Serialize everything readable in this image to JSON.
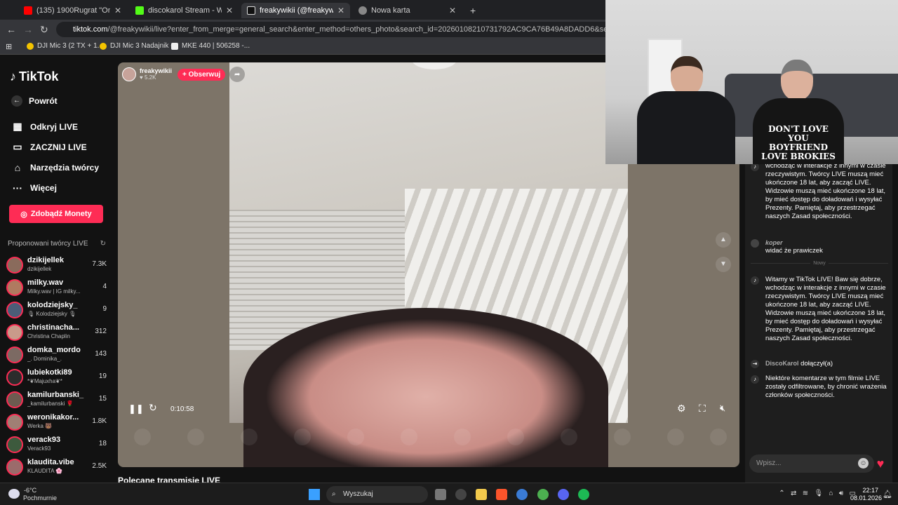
{
  "browser": {
    "tabs": [
      {
        "title": "(135) 1900Rugrat \"One Take Fr",
        "color": "#ff0000",
        "close": "✕"
      },
      {
        "title": "discokarol Stream - Watch Live",
        "color": "#53fc18",
        "close": "✕"
      },
      {
        "title": "freakywikii (@freakywikii) prow",
        "color": "#111111",
        "close": "✕",
        "active": true
      },
      {
        "title": "Nowa karta",
        "color": "#888888",
        "close": "✕"
      }
    ],
    "new_tab": "+",
    "url_host": "tiktok.com",
    "url_rest": "/@freakywikii/live?enter_from_merge=general_search&enter_method=others_photo&search_id=20260108210731792AC9CA76B49A8DADD6&search_keyword=freakywikii&se",
    "bookmarks": [
      "DJI Mic 3 (2 TX + 1...",
      "DJI Mic 3 Nadajnik -...",
      "MKE 440 | 506258 -..."
    ]
  },
  "sidebar": {
    "brand": "TikTok",
    "back": "Powrót",
    "items": [
      {
        "label": "Odkryj LIVE",
        "icon": "calendar-icon"
      },
      {
        "label": "ZACZNIJ LIVE",
        "icon": "video-icon"
      },
      {
        "label": "Narzędzia twórcy",
        "icon": "home-icon"
      },
      {
        "label": "Więcej",
        "icon": "more-icon"
      }
    ],
    "coins_button": "Zdobądź Monety",
    "proposed_title": "Proponowani twórcy LIVE",
    "creators": [
      {
        "name": "dzikijellek",
        "sub": "dzikijellek",
        "count": "7.3K",
        "color": "#8a6b5c"
      },
      {
        "name": "milky.wav",
        "sub": "Milky.wav | IG milky...",
        "count": "4",
        "color": "#b07a60"
      },
      {
        "name": "kolodziejsky_",
        "sub": "🎙 Kolodziejsky 🎙",
        "count": "9",
        "color": "#4b5d78"
      },
      {
        "name": "christinacha...",
        "sub": "Christina Chaplin",
        "count": "312",
        "color": "#c99a8a"
      },
      {
        "name": "domka_mordo",
        "sub": "_. Dominika_.",
        "count": "143",
        "color": "#7c6a63"
      },
      {
        "name": "lubiekotki89",
        "sub": "*❦Majuxha❦*",
        "count": "19",
        "color": "#2c2c2c"
      },
      {
        "name": "kamilurbanski_",
        "sub": "_kamilurbanski 🌹",
        "count": "15",
        "color": "#6d5b50"
      },
      {
        "name": "weronikakor...",
        "sub": "Werka 🐻",
        "count": "1.8K",
        "color": "#a07f74"
      },
      {
        "name": "verack93",
        "sub": "Verack93",
        "count": "18",
        "color": "#3d5a3d"
      },
      {
        "name": "klaudita.vibe",
        "sub": "KLAUDITA 🌸",
        "count": "2.5K",
        "color": "#9b6b6b"
      }
    ]
  },
  "player": {
    "host": "freakywikii",
    "likes": "♥ 5.2K",
    "follow": "+ Obserwuj",
    "time": "0:10:58"
  },
  "recommended_title": "Polecane transmisje LIVE",
  "chat": {
    "messages": [
      {
        "user": "",
        "text": "wchodząc w interakcje z innymi w czasie rzeczywistym. Twórcy LIVE muszą mieć ukończone 18 lat, aby zacząć LIVE. Widzowie muszą mieć ukończone 18 lat, by mieć dostęp do doładowań i wysyłać Prezenty. Pamiętaj, aby przestrzegać naszych Zasad społeczności."
      },
      {
        "user": "koper",
        "text": "widać że prawiczek"
      }
    ],
    "new_label": "Nowy",
    "messages_new": [
      {
        "user": "",
        "text": "Witamy w TikTok LIVE! Baw się dobrze, wchodząc w interakcje z innymi w czasie rzeczywistym. Twórcy LIVE muszą mieć ukończone 18 lat, aby zacząć LIVE. Widzowie muszą mieć ukończone 18 lat, by mieć dostęp do doładowań i wysyłać Prezenty. Pamiętaj, aby przestrzegać naszych Zasad społeczności."
      },
      {
        "user": "DiscoKarol",
        "text": "dołączył(a)"
      },
      {
        "user": "",
        "text": "Niektóre komentarze w tym filmie LIVE zostały odfiltrowane, by chronić wrażenia członków społeczności."
      }
    ],
    "input_placeholder": "Wpisz..."
  },
  "webcam": {
    "shirt_text": "DON'T LOVE YOU BOYFRIEND LOVE BROKIES"
  },
  "taskbar": {
    "temp": "-6°C",
    "weather": "Pochmurnie",
    "search": "Wyszukaj",
    "time": "22:17",
    "date": "08.01.2026"
  }
}
